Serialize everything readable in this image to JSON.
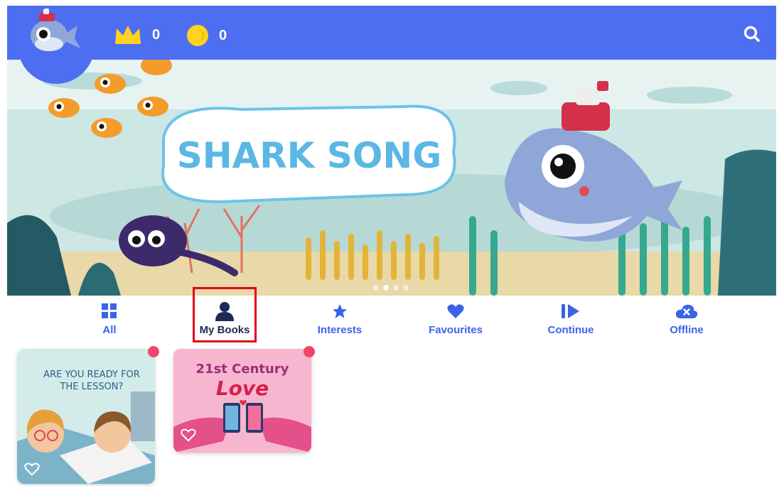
{
  "header": {
    "crowns_count": "0",
    "coins_count": "0",
    "avatar_icon": "shark-avatar-icon",
    "crown_icon": "crown-icon",
    "coin_icon": "coin-icon",
    "search_icon": "search-icon",
    "bar_color": "#4d6ef0"
  },
  "banner": {
    "title": "SHARK SONG",
    "slides": 4,
    "active_slide": 2
  },
  "tabs": [
    {
      "label": "All",
      "icon": "grid-icon"
    },
    {
      "label": "My Books",
      "icon": "person-icon",
      "selected": true
    },
    {
      "label": "Interests",
      "icon": "star-icon"
    },
    {
      "label": "Favourites",
      "icon": "heart-icon"
    },
    {
      "label": "Continue",
      "icon": "play-icon"
    },
    {
      "label": "Offline",
      "icon": "cloud-off-icon"
    }
  ],
  "books": [
    {
      "cover_text": "ARE YOU READY FOR THE LESSON?",
      "favourite": false,
      "new": true
    },
    {
      "cover_line1": "21st Century",
      "cover_line2": "Love",
      "favourite": false,
      "new": true
    }
  ],
  "colors": {
    "accent": "#3a64e8",
    "selected_tab": "#1c2a5a",
    "badge": "#f0466a",
    "highlight": "#e3001b"
  }
}
